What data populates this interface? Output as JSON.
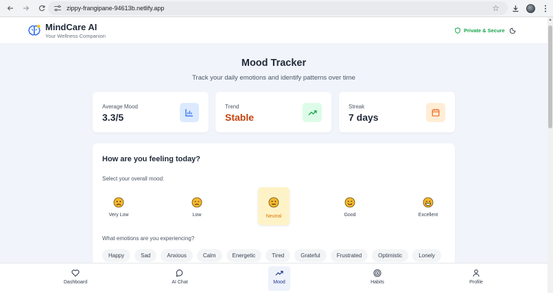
{
  "browser": {
    "url": "zippy-frangipane-94613b.netlify.app"
  },
  "header": {
    "brand_name": "MindCare AI",
    "brand_tagline": "Your Wellness Companion",
    "secure_label": "Private & Secure",
    "accent_color": "#16a34a"
  },
  "page": {
    "title": "Mood Tracker",
    "subtitle": "Track your daily emotions and identify patterns over time"
  },
  "stats": [
    {
      "label": "Average Mood",
      "value": "3.3/5",
      "icon": "bar-chart-icon",
      "value_color": "#1f2937",
      "icon_bg": "#dbeafe",
      "icon_color": "#2563eb"
    },
    {
      "label": "Trend",
      "value": "Stable",
      "icon": "trend-up-icon",
      "value_color": "#c2410c",
      "icon_bg": "#dcfce7",
      "icon_color": "#16a34a"
    },
    {
      "label": "Streak",
      "value": "7 days",
      "icon": "calendar-icon",
      "value_color": "#1f2937",
      "icon_bg": "#ffedd5",
      "icon_color": "#ea580c"
    }
  ],
  "mood_card": {
    "title": "How are you feeling today?",
    "mood_prompt": "Select your overall mood:",
    "moods": [
      {
        "label": "Very Low",
        "selected": false
      },
      {
        "label": "Low",
        "selected": false
      },
      {
        "label": "Neutral",
        "selected": true
      },
      {
        "label": "Good",
        "selected": false
      },
      {
        "label": "Excellent",
        "selected": false
      }
    ],
    "emotion_prompt": "What emotions are you experiencing?",
    "emotions": [
      "Happy",
      "Sad",
      "Anxious",
      "Calm",
      "Energetic",
      "Tired",
      "Grateful",
      "Frustrated",
      "Optimistic",
      "Lonely"
    ]
  },
  "bottom_nav": [
    {
      "label": "Dashboard",
      "icon": "heart-icon",
      "active": false
    },
    {
      "label": "AI Chat",
      "icon": "chat-bubble-icon",
      "active": false
    },
    {
      "label": "Mood",
      "icon": "trend-up-icon",
      "active": true
    },
    {
      "label": "Habits",
      "icon": "target-icon",
      "active": false
    },
    {
      "label": "Profile",
      "icon": "user-icon",
      "active": false
    }
  ]
}
